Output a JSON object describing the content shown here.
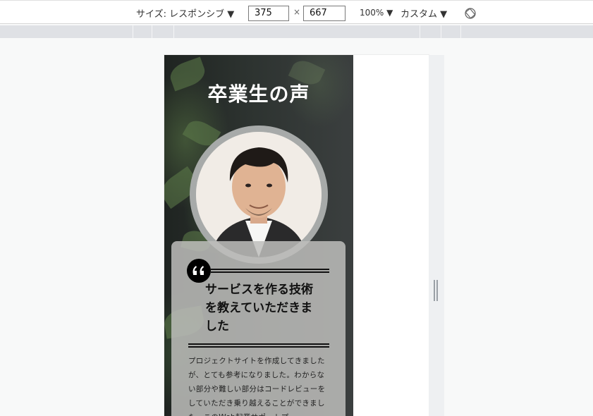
{
  "toolbar": {
    "size_label": "サイズ: レスポンシブ ▼",
    "width_value": "375",
    "height_value": "667",
    "times": "×",
    "zoom_label": "100% ▼",
    "throttle_label": "カスタム ▼",
    "rotate_icon": "rotate-icon"
  },
  "page": {
    "section_title": "卒業生の声",
    "testimonial": {
      "quote_icon": "quote-icon",
      "heading": "サービスを作る技術を教えていただきました",
      "body": "プロジェクトサイトを作成してきましたが、とても参考になりました。わからない部分や難しい部分はコードレビューをしていただき乗り越えることができました。このWeb起業サポートプ"
    }
  },
  "colors": {
    "hero_dark": "#2d3330",
    "card_bg": "#bebebc",
    "ring": "#a7aaa9",
    "title_text": "#ffffff"
  }
}
